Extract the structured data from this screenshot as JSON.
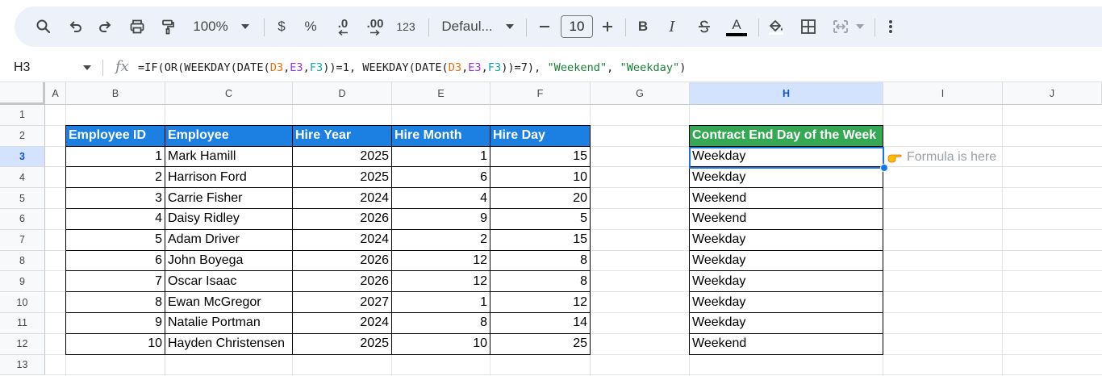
{
  "toolbar": {
    "zoom": "100%",
    "currency": "$",
    "percent": "%",
    "decrease_decimal": ".0",
    "increase_decimal": ".00",
    "number_format": "123",
    "font_name": "Defaul...",
    "font_size": "10",
    "bold": "B",
    "italic": "I",
    "text_color_glyph": "A"
  },
  "formula_bar": {
    "cell_ref": "H3",
    "fx": "fx",
    "formula_parts": [
      "=IF(OR(WEEKDAY(DATE(",
      "D3",
      ",",
      "E3",
      ",",
      "F3",
      "))=1, WEEKDAY(DATE(",
      "D3",
      ",",
      "E3",
      ",",
      "F3",
      "))=7), ",
      "\"Weekend\"",
      ", ",
      "\"Weekday\"",
      ")"
    ]
  },
  "columns": [
    "A",
    "B",
    "C",
    "D",
    "E",
    "F",
    "G",
    "H",
    "I",
    "J"
  ],
  "rows": [
    "1",
    "2",
    "3",
    "4",
    "5",
    "6",
    "7",
    "8",
    "9",
    "10",
    "11",
    "12",
    "13"
  ],
  "table": {
    "headers": [
      "Employee ID",
      "Employee",
      "Hire Year",
      "Hire Month",
      "Hire Day"
    ],
    "data": [
      [
        "1",
        "Mark Hamill",
        "2025",
        "1",
        "15"
      ],
      [
        "2",
        "Harrison Ford",
        "2025",
        "6",
        "10"
      ],
      [
        "3",
        "Carrie Fisher",
        "2024",
        "4",
        "20"
      ],
      [
        "4",
        "Daisy Ridley",
        "2026",
        "9",
        "5"
      ],
      [
        "5",
        "Adam Driver",
        "2024",
        "2",
        "15"
      ],
      [
        "6",
        "John Boyega",
        "2026",
        "12",
        "8"
      ],
      [
        "7",
        "Oscar Isaac",
        "2026",
        "12",
        "8"
      ],
      [
        "8",
        "Ewan McGregor",
        "2027",
        "1",
        "12"
      ],
      [
        "9",
        "Natalie Portman",
        "2024",
        "8",
        "14"
      ],
      [
        "10",
        "Hayden Christensen",
        "2025",
        "10",
        "25"
      ]
    ]
  },
  "result": {
    "header": "Contract End Day of the Week",
    "values": [
      "Weekday",
      "Weekday",
      "Weekend",
      "Weekend",
      "Weekday",
      "Weekday",
      "Weekday",
      "Weekday",
      "Weekday",
      "Weekend"
    ]
  },
  "note": {
    "text": "Formula is here"
  },
  "colors": {
    "header_blue": "#1c80e3",
    "header_green": "#34a853",
    "selection": "#1a73e8"
  }
}
